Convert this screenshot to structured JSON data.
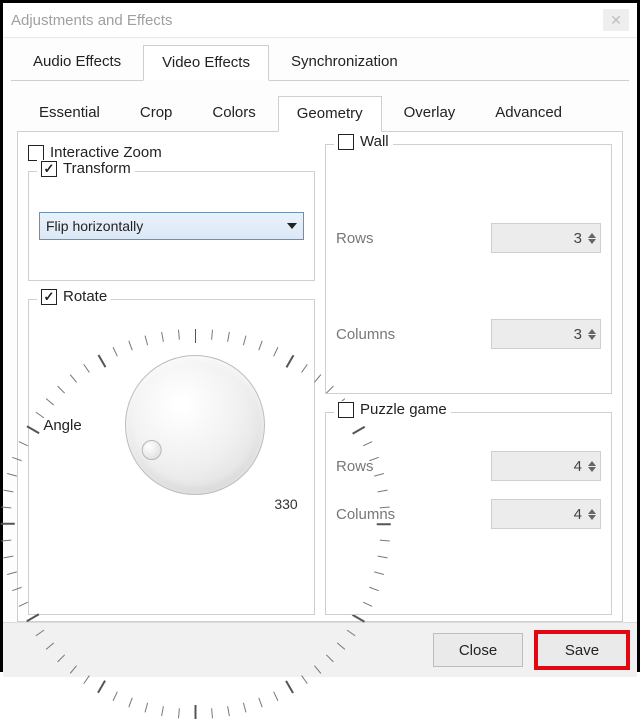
{
  "window": {
    "title": "Adjustments and Effects"
  },
  "main_tabs": {
    "audio": "Audio Effects",
    "video": "Video Effects",
    "sync": "Synchronization"
  },
  "sub_tabs": {
    "essential": "Essential",
    "crop": "Crop",
    "colors": "Colors",
    "geometry": "Geometry",
    "overlay": "Overlay",
    "advanced": "Advanced"
  },
  "geometry": {
    "interactive_zoom_label": "Interactive Zoom",
    "transform_label": "Transform",
    "transform_value": "Flip horizontally",
    "rotate_label": "Rotate",
    "angle_label": "Angle",
    "angle_tick_label": "330",
    "wall": {
      "label": "Wall",
      "rows_label": "Rows",
      "rows_value": "3",
      "cols_label": "Columns",
      "cols_value": "3"
    },
    "puzzle": {
      "label": "Puzzle game",
      "rows_label": "Rows",
      "rows_value": "4",
      "cols_label": "Columns",
      "cols_value": "4"
    }
  },
  "footer": {
    "close": "Close",
    "save": "Save"
  }
}
